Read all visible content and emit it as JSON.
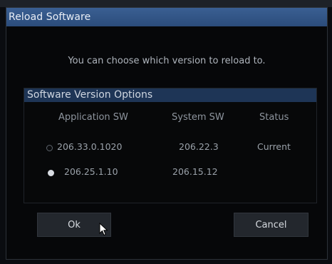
{
  "dialog": {
    "title": "Reload Software",
    "message": "You can choose which version to reload to.",
    "options": {
      "title": "Software Version Options",
      "columns": {
        "application": "Application SW",
        "system": "System SW",
        "status": "Status"
      },
      "rows": [
        {
          "application": "206.33.0.1020",
          "system": "206.22.3",
          "status": "Current",
          "selected": false
        },
        {
          "application": "206.25.1.10",
          "system": "206.15.12",
          "status": "",
          "selected": true
        }
      ]
    },
    "buttons": {
      "ok": "Ok",
      "cancel": "Cancel"
    }
  },
  "colors": {
    "title_bar": "#2f5283",
    "options_header": "#1e3556",
    "background": "#060709"
  },
  "icons": {
    "pointer": "mouse-pointer-icon"
  }
}
